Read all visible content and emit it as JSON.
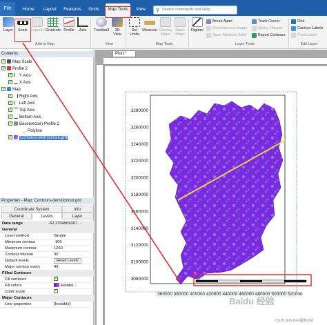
{
  "tabs": {
    "file": "File",
    "items": [
      "Home",
      "Layout",
      "Features",
      "Grids",
      "Map Tools",
      "View"
    ],
    "active": "Map Tools"
  },
  "search": {
    "placeholder": "Search commands and Help..."
  },
  "ribbon": {
    "add_to_map": {
      "label": "Add to Map",
      "buttons": [
        "Layer",
        "Scale",
        "Legend",
        "Graticule",
        "Profile",
        "Axis"
      ]
    },
    "view": {
      "label": "View",
      "buttons": [
        "Trackball",
        "3D View"
      ]
    },
    "map_tools": {
      "label": "Map Tools",
      "buttons": [
        "Set Limits",
        "Measure",
        "Overlay Maps",
        "Stack Maps"
      ]
    },
    "layer_tools": {
      "label": "Layer Tools",
      "digitize": "Digitize",
      "small": [
        "Break Apart",
        "Georeference Image",
        "Open Attribute Table",
        "Track Cursor",
        "Query Objects",
        "Export Contours"
      ]
    },
    "edit_layer": {
      "label": "Edit Layer",
      "small": [
        "Grid",
        "Contour Labels",
        "Post Labels"
      ]
    }
  },
  "contents": {
    "title": "Contents",
    "tree": [
      {
        "label": "Map Scale",
        "indent": 0
      },
      {
        "label": "Profile 2",
        "indent": 0
      },
      {
        "label": "Y Axis",
        "indent": 1
      },
      {
        "label": "X Axis",
        "indent": 1
      },
      {
        "label": "Map",
        "indent": 0
      },
      {
        "label": "Right Axis",
        "indent": 1
      },
      {
        "label": "Left Axis",
        "indent": 1
      },
      {
        "label": "Top Axis",
        "indent": 1
      },
      {
        "label": "Bottom Axis",
        "indent": 1
      },
      {
        "label": "Base(vector)-Profile 2",
        "indent": 1
      },
      {
        "label": "Polyline",
        "indent": 2
      },
      {
        "label": "Contours-dem1kmout.grd",
        "indent": 1
      }
    ]
  },
  "properties": {
    "title": "Properties - Map: Contours-dem1kmout.grd",
    "tabs_row1": [
      "Coordinate System",
      "Info"
    ],
    "tabs_row2": [
      "General",
      "Levels",
      "Layer"
    ],
    "data_range": {
      "key": "Data range",
      "value": "-62.2704969307..."
    },
    "general": "General",
    "rows": [
      {
        "k": "Level method",
        "v": "Simple"
      },
      {
        "k": "Minimum contour",
        "v": "-100"
      },
      {
        "k": "Maximum contour",
        "v": "1250"
      },
      {
        "k": "Contour interval",
        "v": "30"
      },
      {
        "k": "Default levels",
        "v": "Reset Levels"
      },
      {
        "k": "Major contour every",
        "v": "49"
      }
    ],
    "filled_contours": "Filled Contours",
    "filled_rows": [
      {
        "k": "Fill contours",
        "v": ""
      },
      {
        "k": "Fill colors",
        "v": "Rainbo..."
      },
      {
        "k": "Color scale",
        "v": ""
      }
    ],
    "major_contours": "Major Contours",
    "line_properties": {
      "k": "Line properties",
      "v": "[Invisible]"
    }
  },
  "document": {
    "tab": "Plot1*"
  },
  "map": {
    "y_ticks": [
      "3280000",
      "3260000",
      "3240000",
      "3220000",
      "3200000",
      "3180000",
      "3160000",
      "3140000",
      "3120000",
      "3100000",
      "3080000"
    ],
    "x_ticks": [
      "360000",
      "380000",
      "400000",
      "420000",
      "440000",
      "460000",
      "480000",
      "500000",
      "520000"
    ],
    "colors": {
      "accent": "#1f5fa9",
      "highlight": "#e3312f",
      "fill_primary": "#7a2be0",
      "fill_secondary": "#9b6fe8",
      "profile_line": "#f2d23c"
    }
  },
  "watermark": "Baidu 经验",
  "credit": "CSDN @Python图像识别"
}
